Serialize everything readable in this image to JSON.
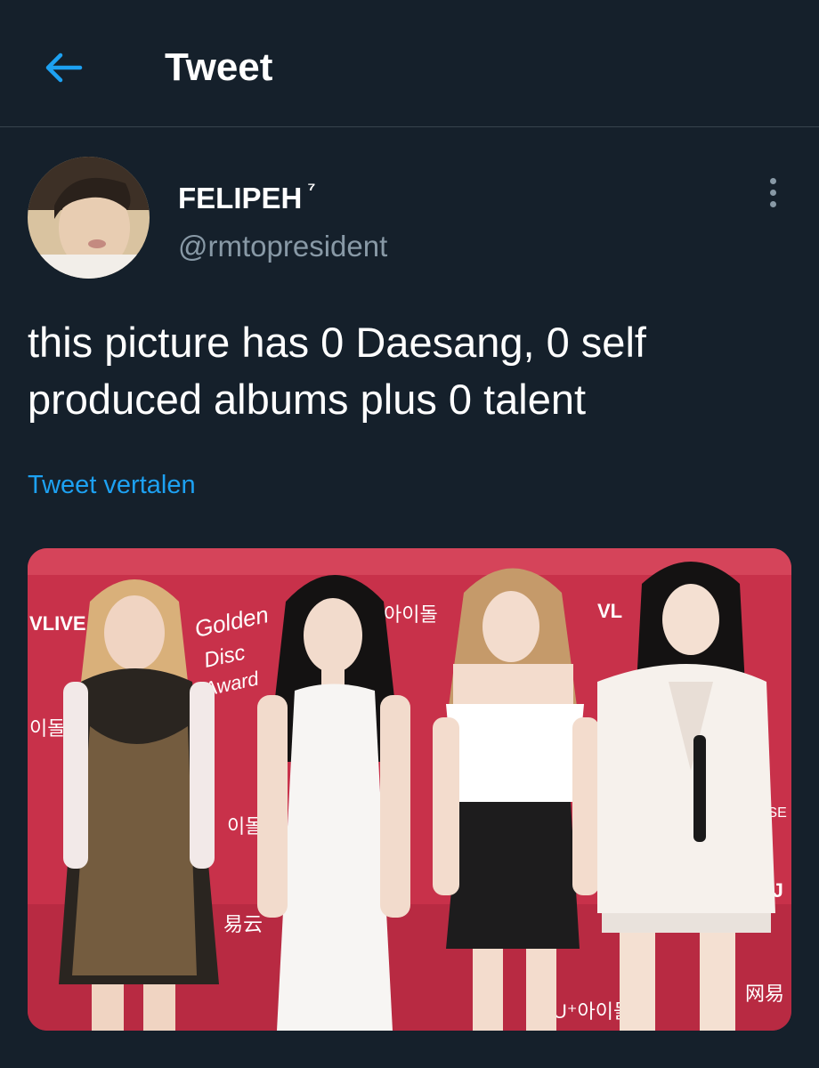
{
  "header": {
    "back_icon": "arrow-left-icon",
    "title": "Tweet"
  },
  "tweet": {
    "author": {
      "display_name": "FELIPEH",
      "badge": "⁷",
      "handle": "@rmtopresident"
    },
    "more_icon": "more-vertical-icon",
    "text": "this picture has 0 Daesang, 0 self produced albums plus 0 talent",
    "translate_label": "Tweet vertalen"
  },
  "media": {
    "backdrop_texts": {
      "vlive_left": "VLIVE",
      "idol_top": "아이돌",
      "vlive_right": "VL",
      "golden_disc_1": "Golden",
      "golden_disc_2": "Disc",
      "golden_disc_3": "Award",
      "idol_left": "이돌",
      "idol_mid": "이돌",
      "netease_cloud": "易云",
      "idol_bottom": "U⁺아이돌",
      "netease_right": "网易",
      "sj_plan": "SJ",
      "yl_se": "YL SE"
    }
  },
  "colors": {
    "background": "#15202b",
    "accent": "#1da1f2",
    "secondary_text": "#8899a6",
    "divider": "#38444d",
    "backdrop": "#c8314a"
  }
}
